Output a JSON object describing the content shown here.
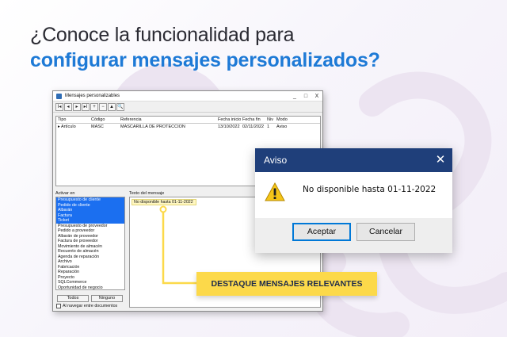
{
  "headline": {
    "line1": "¿Conoce la funcionalidad para",
    "line2": "configurar mensajes personalizados?"
  },
  "colors": {
    "headline_dark": "#2b2b33",
    "headline_accent": "#1e7ad6",
    "dialog_title_bar": "#1f3f7a",
    "callout_bg": "#fcd94a",
    "callout_text": "#1d2b4c",
    "list_selection": "#1b6ff0"
  },
  "window": {
    "title": "Mensajes personalizables",
    "title_buttons": [
      "_",
      "□",
      "X"
    ],
    "toolbar": [
      "I◂",
      "◂",
      "▸",
      "▸I",
      "+",
      "−",
      "▲",
      "🔍"
    ],
    "grid": {
      "columns": [
        "Tipo",
        "Código",
        "Referencia",
        "Fecha inicio",
        "Fecha fin",
        "Niv",
        "Modo"
      ],
      "rows": [
        [
          "▸ Artículo",
          "MASC",
          "MASCARILLA DE PROTECCION",
          "13/10/2022",
          "02/11/2022",
          "1",
          "Aviso"
        ]
      ]
    },
    "activar_label": "Activar en",
    "activar_items": [
      {
        "label": "Presupuesto de cliente",
        "selected": true
      },
      {
        "label": "Pedido de cliente",
        "selected": true
      },
      {
        "label": "Albarán",
        "selected": true
      },
      {
        "label": "Factura",
        "selected": true
      },
      {
        "label": "Ticket",
        "selected": true
      },
      {
        "label": "Presupuesto de proveedor",
        "selected": false
      },
      {
        "label": "Pedido a proveedor",
        "selected": false
      },
      {
        "label": "Albarán de proveedor",
        "selected": false
      },
      {
        "label": "Factura de proveedor",
        "selected": false
      },
      {
        "label": "Movimiento de almacén",
        "selected": false
      },
      {
        "label": "Recuento de almacén",
        "selected": false
      },
      {
        "label": "Agenda de reparación",
        "selected": false
      },
      {
        "label": "Archivo",
        "selected": false
      },
      {
        "label": "Fabricación",
        "selected": false
      },
      {
        "label": "Reparación",
        "selected": false
      },
      {
        "label": "Proyecto",
        "selected": false
      },
      {
        "label": "SQLCommerce",
        "selected": false
      },
      {
        "label": "Oportunidad de negocio",
        "selected": false
      }
    ],
    "todos_label": "Todos",
    "ninguno_label": "Ninguno",
    "navegar_label": "Al navegar entre documentos",
    "texto_label": "Texto del mensaje",
    "message_text": "No disponible hasta 01-11-2022"
  },
  "dialog": {
    "title": "Aviso",
    "close_icon": "close-icon",
    "message": "No disponible hasta 01-11-2022",
    "accept_label": "Aceptar",
    "cancel_label": "Cancelar",
    "icon": "warning-icon"
  },
  "callout": {
    "label": "DESTAQUE MENSAJES RELEVANTES"
  }
}
